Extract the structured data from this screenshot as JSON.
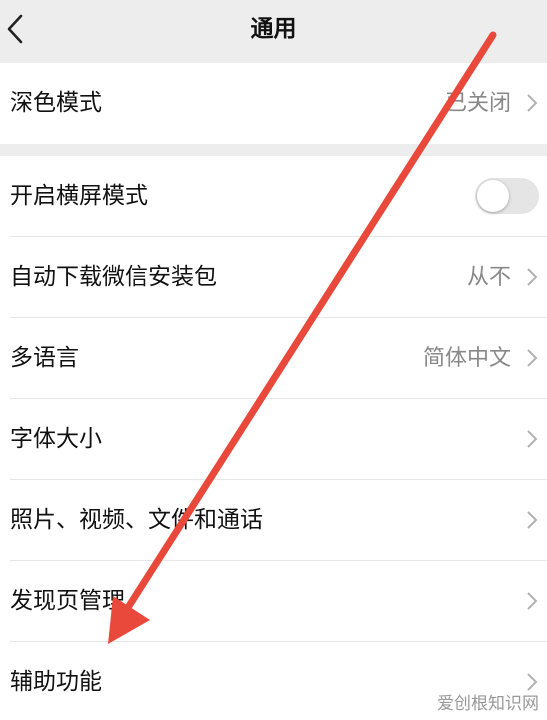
{
  "nav": {
    "title": "通用",
    "back_icon": "chevron-left-icon"
  },
  "group1": [
    {
      "label": "深色模式",
      "value": "已关闭"
    }
  ],
  "group2": [
    {
      "label": "开启横屏模式",
      "toggle": false
    },
    {
      "label": "自动下载微信安装包",
      "value": "从不"
    },
    {
      "label": "多语言",
      "value": "简体中文"
    },
    {
      "label": "字体大小",
      "value": ""
    },
    {
      "label": "照片、视频、文件和通话",
      "value": ""
    },
    {
      "label": "发现页管理",
      "value": ""
    },
    {
      "label": "辅助功能",
      "value": ""
    }
  ],
  "watermark": "爱创根知识网",
  "colors": {
    "background": "#ededed",
    "row": "#ffffff",
    "arrow": "#e8493b",
    "secondary_text": "#888888"
  }
}
